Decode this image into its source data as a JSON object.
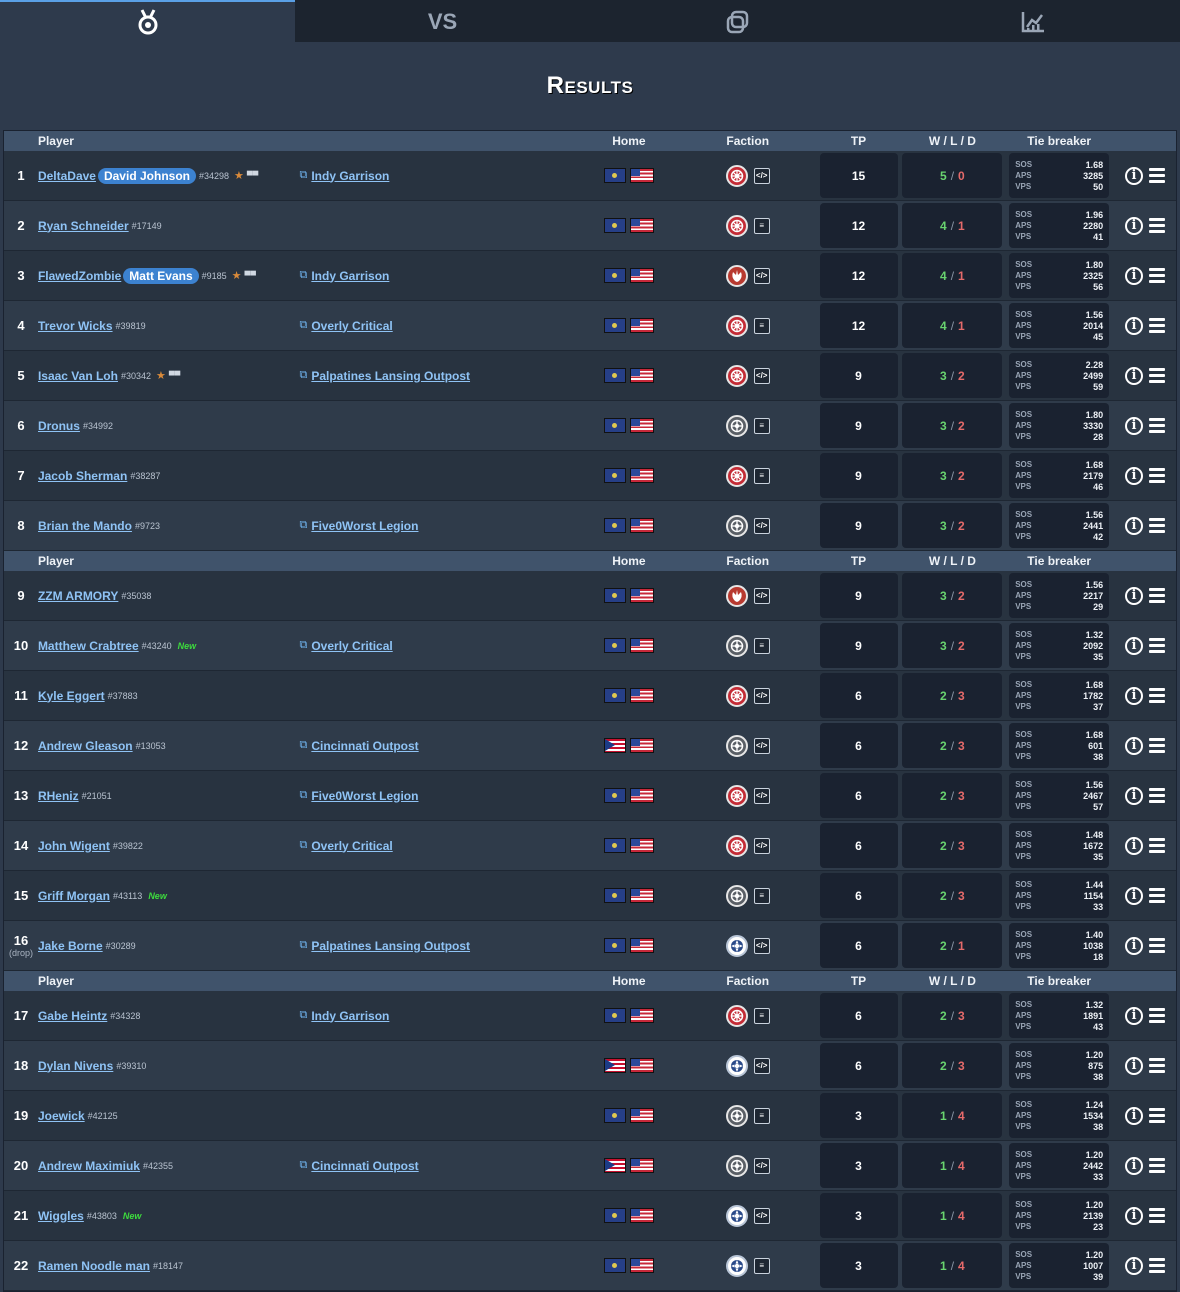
{
  "tabs": [
    {
      "key": "medal",
      "icon": "medal-icon",
      "label": "",
      "active": true
    },
    {
      "key": "vs",
      "icon": "",
      "label": "VS",
      "active": false
    },
    {
      "key": "pairings",
      "icon": "copy-icon",
      "label": "",
      "active": false
    },
    {
      "key": "stats",
      "icon": "chart-icon",
      "label": "",
      "active": false
    }
  ],
  "title": "Results",
  "headers": {
    "player": "Player",
    "home": "Home",
    "faction": "Faction",
    "tp": "TP",
    "wld": "W / L / D",
    "tiebreaker": "Tie breaker"
  },
  "tb_labels": {
    "sos": "SOS",
    "aps": "APS",
    "vps": "VPS"
  },
  "colors": {
    "accent": "#5aa0e6",
    "link": "#8fc3f5",
    "win": "#69d46f",
    "loss": "#e56a6a",
    "new": "#3ddb3d"
  },
  "sections": [
    {
      "rows": [
        {
          "rank": "1",
          "rank_note": "",
          "name": "DeltaDave",
          "alias": "David Johnson",
          "pid": "#34298",
          "star": true,
          "trophy": true,
          "new": false,
          "club": "Indy Garrison",
          "home": "state",
          "faction": "galactic_empire",
          "list": "code",
          "tp": "15",
          "w": "5",
          "l": "0",
          "sos": "1.68",
          "aps": "3285",
          "vps": "50"
        },
        {
          "rank": "2",
          "rank_note": "",
          "name": "Ryan Schneider",
          "alias": "",
          "pid": "#17149",
          "star": false,
          "trophy": false,
          "new": false,
          "club": "",
          "home": "state",
          "faction": "galactic_empire",
          "list": "doc",
          "tp": "12",
          "w": "4",
          "l": "1",
          "sos": "1.96",
          "aps": "2280",
          "vps": "41"
        },
        {
          "rank": "3",
          "rank_note": "",
          "name": "FlawedZombie",
          "alias": "Matt Evans",
          "pid": "#9185",
          "star": true,
          "trophy": true,
          "new": false,
          "club": "Indy Garrison",
          "home": "state",
          "faction": "rebel_alliance",
          "list": "code",
          "tp": "12",
          "w": "4",
          "l": "1",
          "sos": "1.80",
          "aps": "2325",
          "vps": "56"
        },
        {
          "rank": "4",
          "rank_note": "",
          "name": "Trevor Wicks",
          "alias": "",
          "pid": "#39819",
          "star": false,
          "trophy": false,
          "new": false,
          "club": "Overly Critical",
          "home": "state",
          "faction": "galactic_empire",
          "list": "doc",
          "tp": "12",
          "w": "4",
          "l": "1",
          "sos": "1.56",
          "aps": "2014",
          "vps": "45"
        },
        {
          "rank": "5",
          "rank_note": "",
          "name": "Isaac Van Loh",
          "alias": "",
          "pid": "#30342",
          "star": true,
          "trophy": true,
          "new": false,
          "club": "Palpatines Lansing Outpost",
          "home": "state",
          "faction": "galactic_empire",
          "list": "code",
          "tp": "9",
          "w": "3",
          "l": "2",
          "sos": "2.28",
          "aps": "2499",
          "vps": "59"
        },
        {
          "rank": "6",
          "rank_note": "",
          "name": "Dronus",
          "alias": "",
          "pid": "#34992",
          "star": false,
          "trophy": false,
          "new": false,
          "club": "",
          "home": "state",
          "faction": "first_order",
          "list": "doc",
          "tp": "9",
          "w": "3",
          "l": "2",
          "sos": "1.80",
          "aps": "3330",
          "vps": "28"
        },
        {
          "rank": "7",
          "rank_note": "",
          "name": "Jacob Sherman",
          "alias": "",
          "pid": "#38287",
          "star": false,
          "trophy": false,
          "new": false,
          "club": "",
          "home": "state",
          "faction": "galactic_empire",
          "list": "doc",
          "tp": "9",
          "w": "3",
          "l": "2",
          "sos": "1.68",
          "aps": "2179",
          "vps": "46"
        },
        {
          "rank": "8",
          "rank_note": "",
          "name": "Brian the Mando",
          "alias": "",
          "pid": "#9723",
          "star": false,
          "trophy": false,
          "new": false,
          "club": "Five0Worst Legion",
          "home": "state",
          "faction": "first_order",
          "list": "code",
          "tp": "9",
          "w": "3",
          "l": "2",
          "sos": "1.56",
          "aps": "2441",
          "vps": "42"
        }
      ]
    },
    {
      "rows": [
        {
          "rank": "9",
          "rank_note": "",
          "name": "ZZM ARMORY",
          "alias": "",
          "pid": "#35038",
          "star": false,
          "trophy": false,
          "new": false,
          "club": "",
          "home": "state",
          "faction": "rebel_alliance",
          "list": "code",
          "tp": "9",
          "w": "3",
          "l": "2",
          "sos": "1.56",
          "aps": "2217",
          "vps": "29"
        },
        {
          "rank": "10",
          "rank_note": "",
          "name": "Matthew Crabtree",
          "alias": "",
          "pid": "#43240",
          "star": false,
          "trophy": false,
          "new": true,
          "club": "Overly Critical",
          "home": "state",
          "faction": "first_order",
          "list": "doc",
          "tp": "9",
          "w": "3",
          "l": "2",
          "sos": "1.32",
          "aps": "2092",
          "vps": "35"
        },
        {
          "rank": "11",
          "rank_note": "",
          "name": "Kyle Eggert",
          "alias": "",
          "pid": "#37883",
          "star": false,
          "trophy": false,
          "new": false,
          "club": "",
          "home": "state",
          "faction": "galactic_empire",
          "list": "code",
          "tp": "6",
          "w": "2",
          "l": "3",
          "sos": "1.68",
          "aps": "1782",
          "vps": "37"
        },
        {
          "rank": "12",
          "rank_note": "",
          "name": "Andrew Gleason",
          "alias": "",
          "pid": "#13053",
          "star": false,
          "trophy": false,
          "new": false,
          "club": "Cincinnati Outpost",
          "home": "ohio",
          "faction": "first_order",
          "list": "code",
          "tp": "6",
          "w": "2",
          "l": "3",
          "sos": "1.68",
          "aps": "601",
          "vps": "38"
        },
        {
          "rank": "13",
          "rank_note": "",
          "name": "RHeniz",
          "alias": "",
          "pid": "#21051",
          "star": false,
          "trophy": false,
          "new": false,
          "club": "Five0Worst Legion",
          "home": "state",
          "faction": "galactic_empire",
          "list": "code",
          "tp": "6",
          "w": "2",
          "l": "3",
          "sos": "1.56",
          "aps": "2467",
          "vps": "57"
        },
        {
          "rank": "14",
          "rank_note": "",
          "name": "John Wigent",
          "alias": "",
          "pid": "#39822",
          "star": false,
          "trophy": false,
          "new": false,
          "club": "Overly Critical",
          "home": "state",
          "faction": "galactic_empire",
          "list": "code",
          "tp": "6",
          "w": "2",
          "l": "3",
          "sos": "1.48",
          "aps": "1672",
          "vps": "35"
        },
        {
          "rank": "15",
          "rank_note": "",
          "name": "Griff Morgan",
          "alias": "",
          "pid": "#43113",
          "star": false,
          "trophy": false,
          "new": true,
          "club": "",
          "home": "state",
          "faction": "first_order",
          "list": "doc",
          "tp": "6",
          "w": "2",
          "l": "3",
          "sos": "1.44",
          "aps": "1154",
          "vps": "33"
        },
        {
          "rank": "16",
          "rank_note": "(drop)",
          "name": "Jake Borne",
          "alias": "",
          "pid": "#30289",
          "star": false,
          "trophy": false,
          "new": false,
          "club": "Palpatines Lansing Outpost",
          "home": "state",
          "faction": "separatist",
          "list": "code",
          "tp": "6",
          "w": "2",
          "l": "1",
          "sos": "1.40",
          "aps": "1038",
          "vps": "18"
        }
      ]
    },
    {
      "rows": [
        {
          "rank": "17",
          "rank_note": "",
          "name": "Gabe Heintz",
          "alias": "",
          "pid": "#34328",
          "star": false,
          "trophy": false,
          "new": false,
          "club": "Indy Garrison",
          "home": "state",
          "faction": "galactic_empire",
          "list": "doc",
          "tp": "6",
          "w": "2",
          "l": "3",
          "sos": "1.32",
          "aps": "1891",
          "vps": "43"
        },
        {
          "rank": "18",
          "rank_note": "",
          "name": "Dylan Nivens",
          "alias": "",
          "pid": "#39310",
          "star": false,
          "trophy": false,
          "new": false,
          "club": "",
          "home": "ohio",
          "faction": "separatist",
          "list": "code",
          "tp": "6",
          "w": "2",
          "l": "3",
          "sos": "1.20",
          "aps": "875",
          "vps": "38"
        },
        {
          "rank": "19",
          "rank_note": "",
          "name": "Joewick",
          "alias": "",
          "pid": "#42125",
          "star": false,
          "trophy": false,
          "new": false,
          "club": "",
          "home": "state",
          "faction": "first_order",
          "list": "doc",
          "tp": "3",
          "w": "1",
          "l": "4",
          "sos": "1.24",
          "aps": "1534",
          "vps": "38"
        },
        {
          "rank": "20",
          "rank_note": "",
          "name": "Andrew Maximiuk",
          "alias": "",
          "pid": "#42355",
          "star": false,
          "trophy": false,
          "new": false,
          "club": "Cincinnati Outpost",
          "home": "ohio",
          "faction": "first_order",
          "list": "code",
          "tp": "3",
          "w": "1",
          "l": "4",
          "sos": "1.20",
          "aps": "2442",
          "vps": "33"
        },
        {
          "rank": "21",
          "rank_note": "",
          "name": "Wiggles",
          "alias": "",
          "pid": "#43803",
          "star": false,
          "trophy": false,
          "new": true,
          "club": "",
          "home": "state",
          "faction": "separatist",
          "list": "code",
          "tp": "3",
          "w": "1",
          "l": "4",
          "sos": "1.20",
          "aps": "2139",
          "vps": "23"
        },
        {
          "rank": "22",
          "rank_note": "",
          "name": "Ramen Noodle man",
          "alias": "",
          "pid": "#18147",
          "star": false,
          "trophy": false,
          "new": false,
          "club": "",
          "home": "state",
          "faction": "separatist",
          "list": "doc",
          "tp": "3",
          "w": "1",
          "l": "4",
          "sos": "1.20",
          "aps": "1007",
          "vps": "39"
        }
      ]
    }
  ]
}
